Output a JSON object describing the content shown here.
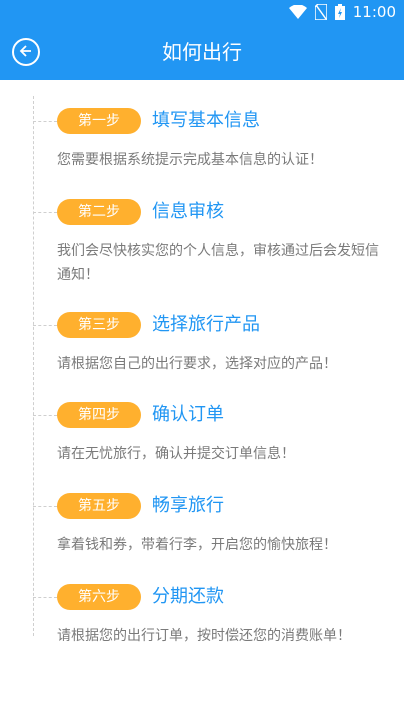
{
  "status_bar": {
    "time": "11:00",
    "icons": [
      "wifi-icon",
      "no-sim-icon",
      "battery-charging-icon"
    ]
  },
  "header": {
    "title": "如何出行",
    "back_icon": "back-arrow-icon"
  },
  "colors": {
    "primary": "#2196f3",
    "badge": "#ffb02e",
    "desc_text": "#7a7a7a"
  },
  "steps": [
    {
      "badge": "第一步",
      "title": "填写基本信息",
      "desc": "您需要根据系统提示完成基本信息的认证！"
    },
    {
      "badge": "第二步",
      "title": "信息审核",
      "desc": "我们会尽快核实您的个人信息，审核通过后会发短信通知！"
    },
    {
      "badge": "第三步",
      "title": "选择旅行产品",
      "desc": "请根据您自己的出行要求，选择对应的产品！"
    },
    {
      "badge": "第四步",
      "title": "确认订单",
      "desc": "请在无忧旅行，确认并提交订单信息！"
    },
    {
      "badge": "第五步",
      "title": "畅享旅行",
      "desc": "拿着钱和券，带着行李，开启您的愉快旅程！"
    },
    {
      "badge": "第六步",
      "title": "分期还款",
      "desc": "请根据您的出行订单，按时偿还您的消费账单！"
    }
  ]
}
